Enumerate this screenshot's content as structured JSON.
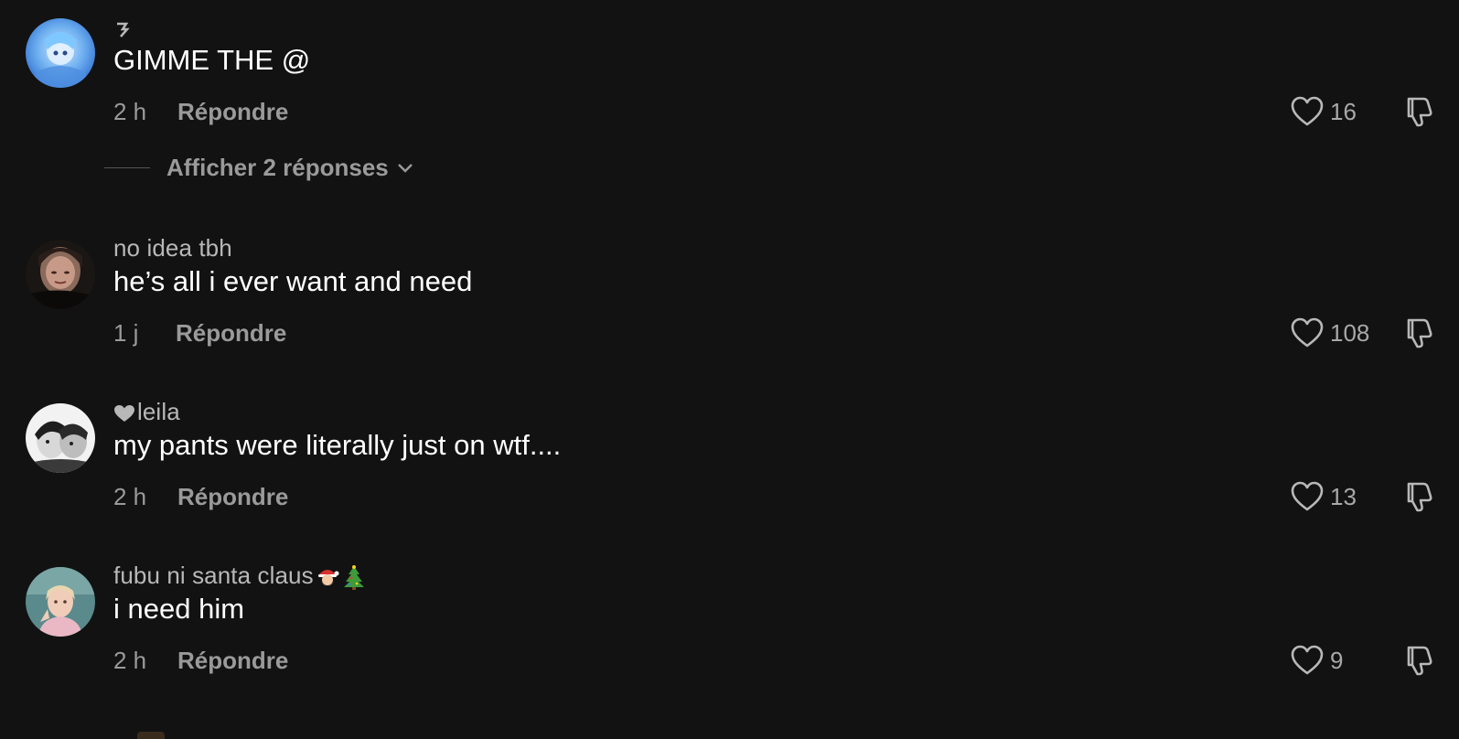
{
  "comments": [
    {
      "username": "",
      "text": "GIMME THE @",
      "time": "2 h",
      "reply_label": "Répondre",
      "likes": "16",
      "avatar": "anime-avatar",
      "view_replies": "Afficher 2 réponses"
    },
    {
      "username": "no idea tbh",
      "text": "he’s all i ever want and need",
      "time": "1 j",
      "reply_label": "Répondre",
      "likes": "108",
      "avatar": "selfie-avatar"
    },
    {
      "username": "leila",
      "username_prefix_icon": "heart-icon",
      "text": "my pants were literally just on wtf....",
      "time": "2 h",
      "reply_label": "Répondre",
      "likes": "13",
      "avatar": "bw-photo-avatar"
    },
    {
      "username": "fubu ni santa claus",
      "username_suffix_icons": [
        "santa-emoji",
        "christmas-tree-emoji"
      ],
      "text": "i need him",
      "time": "2 h",
      "reply_label": "Répondre",
      "likes": "9",
      "avatar": "pink-photo-avatar"
    }
  ],
  "colors": {
    "background": "#121212",
    "text_primary": "#ffffff",
    "text_secondary": "#9a9a9a"
  }
}
